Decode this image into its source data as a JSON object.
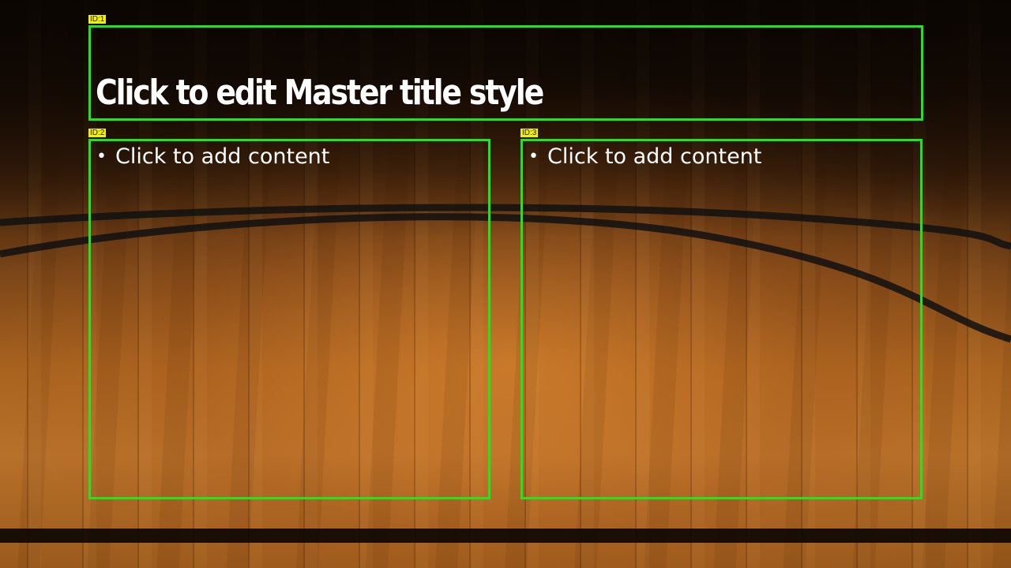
{
  "slide": {
    "title_placeholder": {
      "id_label": "ID:1",
      "text": "Click to edit Master title style"
    },
    "content_left": {
      "id_label": "ID:2",
      "bullet_icon": "bullet-dot",
      "text": "Click to add content"
    },
    "content_right": {
      "id_label": "ID:3",
      "bullet_icon": "bullet-dot",
      "text": "Click to add content"
    }
  },
  "colors": {
    "highlight_border": "#1ee61e",
    "id_label_bg": "#f2f200",
    "text": "#ffffff"
  }
}
